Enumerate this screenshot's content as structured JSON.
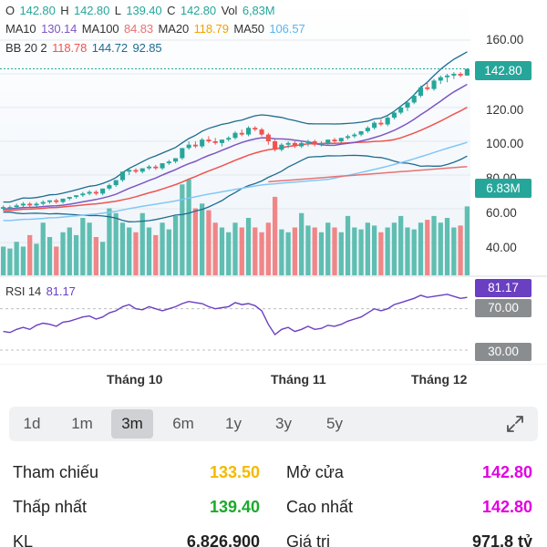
{
  "ohlc": {
    "o_label": "O",
    "o_value": "142.80",
    "h_label": "H",
    "h_value": "142.80",
    "l_label": "L",
    "l_value": "139.40",
    "c_label": "C",
    "c_value": "142.80",
    "vol_label": "Vol",
    "vol_value": "6,83M"
  },
  "ma": {
    "ma10_label": "MA10",
    "ma10_value": "130.14",
    "ma100_label": "MA100",
    "ma100_value": "84.83",
    "ma20_label": "MA20",
    "ma20_value": "118.79",
    "ma50_label": "MA50",
    "ma50_value": "106.57"
  },
  "bb": {
    "label": "BB 20 2",
    "v1": "118.78",
    "v2": "144.72",
    "v3": "92.85"
  },
  "rsi": {
    "label": "RSI 14",
    "value": "81.17"
  },
  "tags": {
    "price": "142.80",
    "volume": "6.83M",
    "rsi": "81.17",
    "rsi_high": "70.00",
    "rsi_low": "30.00"
  },
  "months": [
    "Tháng 10",
    "Tháng 11",
    "Tháng 12"
  ],
  "ranges": [
    "1d",
    "1m",
    "3m",
    "6m",
    "1y",
    "3y",
    "5y"
  ],
  "active_range": "3m",
  "info": {
    "ref_label": "Tham chiếu",
    "ref_value": "133.50",
    "open_label": "Mở cửa",
    "open_value": "142.80",
    "low_label": "Thấp nhất",
    "low_value": "139.40",
    "high_label": "Cao nhất",
    "high_value": "142.80",
    "vol_label": "KL",
    "vol_value": "6,826,900",
    "value_label": "Giá trị",
    "value_value": "971,8 tỷ"
  },
  "colors": {
    "up": "#26a69a",
    "down": "#ef5350",
    "ma10": "#7e57c2",
    "ma20": "#ef5350",
    "ma50": "#81c7f5",
    "ma100": "#e57373",
    "bb": "#1f6b8e",
    "ref": "#f5b800",
    "ceil": "#e000e0",
    "floor": "#1aaa2a",
    "rsi": "#6a3fc1"
  },
  "chart_data": {
    "type": "candlestick",
    "y_ticks": [
      40,
      60,
      80,
      100,
      120,
      140,
      160
    ],
    "ylim": [
      20,
      166
    ],
    "rsi_levels": [
      70,
      30
    ],
    "candles": [
      [
        60,
        62,
        59,
        61
      ],
      [
        61,
        62,
        60,
        61
      ],
      [
        61,
        63,
        60,
        62
      ],
      [
        62,
        64,
        61,
        63
      ],
      [
        63,
        64,
        61,
        62
      ],
      [
        62,
        64,
        61,
        63
      ],
      [
        63,
        65,
        62,
        64
      ],
      [
        64,
        65,
        63,
        65
      ],
      [
        65,
        66,
        63,
        64
      ],
      [
        64,
        66,
        63,
        66
      ],
      [
        66,
        67,
        65,
        67
      ],
      [
        67,
        68,
        66,
        68
      ],
      [
        68,
        70,
        67,
        69
      ],
      [
        69,
        71,
        68,
        70
      ],
      [
        70,
        71,
        68,
        69
      ],
      [
        69,
        72,
        68,
        72
      ],
      [
        72,
        75,
        71,
        74
      ],
      [
        74,
        77,
        73,
        77
      ],
      [
        77,
        82,
        76,
        82
      ],
      [
        82,
        84,
        80,
        83
      ],
      [
        83,
        84,
        81,
        82
      ],
      [
        82,
        84,
        81,
        84
      ],
      [
        84,
        86,
        83,
        85
      ],
      [
        85,
        86,
        83,
        84
      ],
      [
        84,
        87,
        83,
        87
      ],
      [
        87,
        89,
        86,
        88
      ],
      [
        88,
        90,
        87,
        90
      ],
      [
        90,
        96,
        89,
        96
      ],
      [
        96,
        100,
        95,
        98
      ],
      [
        98,
        100,
        96,
        97
      ],
      [
        97,
        102,
        96,
        101
      ],
      [
        101,
        103,
        99,
        100
      ],
      [
        100,
        102,
        98,
        99
      ],
      [
        99,
        101,
        97,
        101
      ],
      [
        101,
        103,
        100,
        102
      ],
      [
        102,
        106,
        101,
        105
      ],
      [
        105,
        107,
        103,
        104
      ],
      [
        104,
        109,
        103,
        108
      ],
      [
        108,
        109,
        106,
        107
      ],
      [
        107,
        108,
        103,
        104
      ],
      [
        104,
        105,
        98,
        100
      ],
      [
        100,
        101,
        94,
        95
      ],
      [
        95,
        99,
        94,
        98
      ],
      [
        98,
        100,
        96,
        99
      ],
      [
        99,
        100,
        96,
        97
      ],
      [
        97,
        100,
        96,
        99
      ],
      [
        99,
        101,
        97,
        100
      ],
      [
        100,
        101,
        97,
        98
      ],
      [
        98,
        100,
        97,
        99
      ],
      [
        99,
        101,
        98,
        101
      ],
      [
        101,
        102,
        99,
        100
      ],
      [
        100,
        102,
        99,
        102
      ],
      [
        102,
        104,
        101,
        103
      ],
      [
        103,
        105,
        102,
        104
      ],
      [
        104,
        106,
        103,
        106
      ],
      [
        106,
        109,
        105,
        108
      ],
      [
        108,
        112,
        107,
        111
      ],
      [
        111,
        113,
        109,
        110
      ],
      [
        110,
        115,
        109,
        114
      ],
      [
        114,
        118,
        113,
        117
      ],
      [
        117,
        121,
        116,
        120
      ],
      [
        120,
        124,
        118,
        123
      ],
      [
        123,
        128,
        122,
        127
      ],
      [
        127,
        133,
        126,
        132
      ],
      [
        132,
        135,
        130,
        131
      ],
      [
        131,
        137,
        130,
        136
      ],
      [
        136,
        139,
        134,
        138
      ],
      [
        138,
        140,
        135,
        139
      ],
      [
        139,
        141,
        137,
        140
      ],
      [
        140,
        141,
        138,
        139
      ],
      [
        139,
        143,
        139,
        143
      ]
    ],
    "volume_rel": [
      0.3,
      0.28,
      0.35,
      0.3,
      0.42,
      0.33,
      0.55,
      0.4,
      0.3,
      0.45,
      0.5,
      0.42,
      0.6,
      0.55,
      0.4,
      0.35,
      0.7,
      0.65,
      0.55,
      0.5,
      0.45,
      0.65,
      0.5,
      0.42,
      0.55,
      0.48,
      0.62,
      0.95,
      1.0,
      0.7,
      0.75,
      0.68,
      0.55,
      0.5,
      0.45,
      0.55,
      0.5,
      0.6,
      0.5,
      0.45,
      0.55,
      0.82,
      0.48,
      0.45,
      0.5,
      0.65,
      0.52,
      0.5,
      0.45,
      0.55,
      0.5,
      0.45,
      0.62,
      0.5,
      0.48,
      0.55,
      0.52,
      0.45,
      0.5,
      0.55,
      0.62,
      0.5,
      0.48,
      0.55,
      0.58,
      0.62,
      0.55,
      0.6,
      0.5,
      0.52,
      0.72
    ],
    "rsi_values": [
      48,
      47,
      50,
      52,
      50,
      54,
      56,
      55,
      53,
      57,
      58,
      60,
      62,
      63,
      60,
      62,
      66,
      68,
      72,
      74,
      70,
      69,
      72,
      70,
      68,
      70,
      72,
      75,
      77,
      76,
      75,
      72,
      70,
      71,
      72,
      76,
      74,
      75,
      73,
      68,
      55,
      45,
      50,
      52,
      48,
      50,
      53,
      50,
      51,
      54,
      53,
      55,
      58,
      60,
      62,
      66,
      70,
      68,
      70,
      74,
      76,
      78,
      80,
      83,
      81,
      82,
      83,
      84,
      82,
      80,
      81
    ]
  }
}
